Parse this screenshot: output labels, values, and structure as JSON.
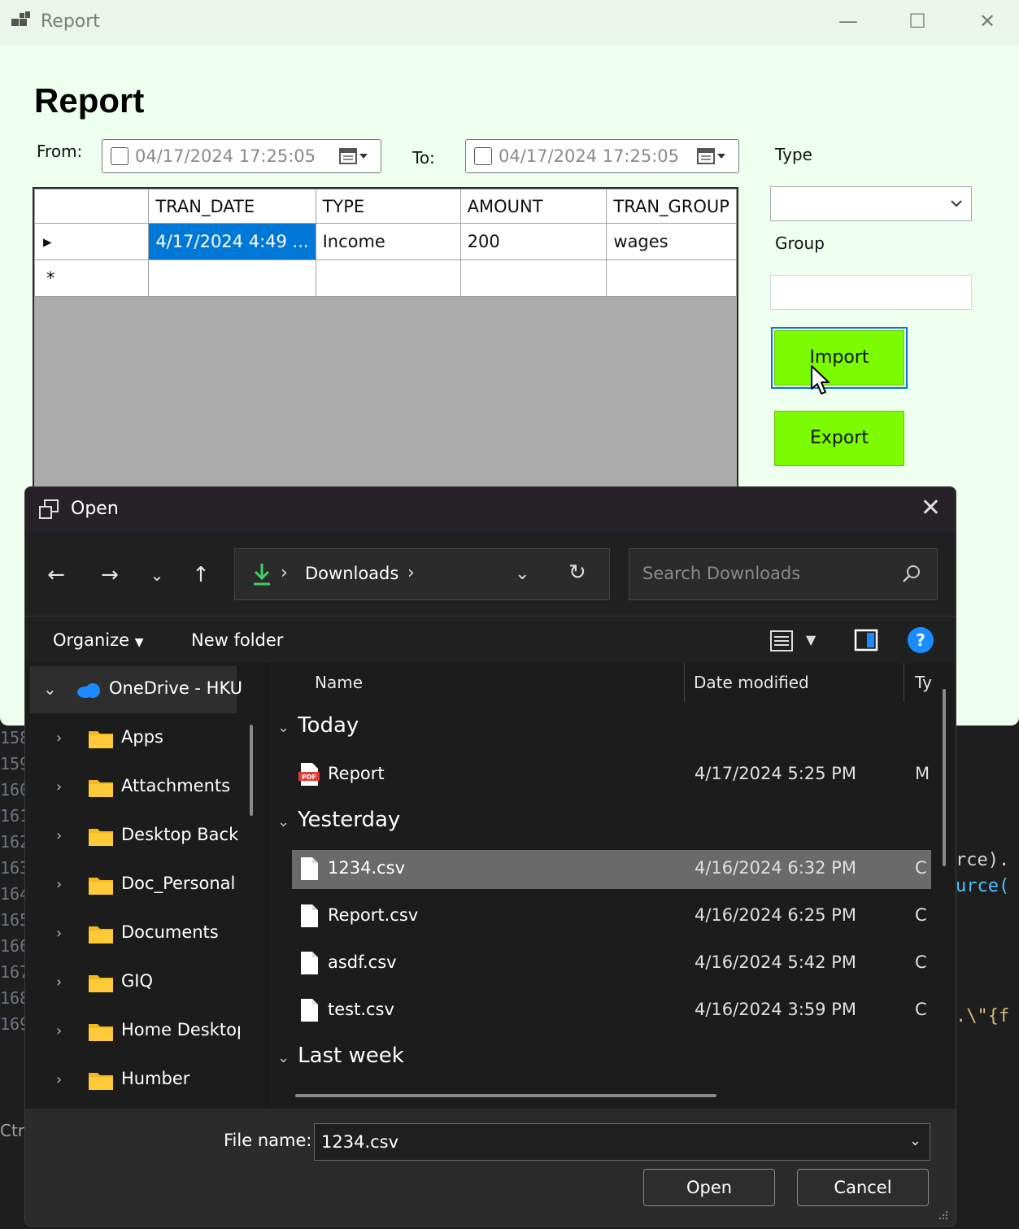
{
  "background": {
    "line_numbers": [
      "158",
      "159",
      "160",
      "161",
      "162",
      "163",
      "164",
      "165",
      "166",
      "167",
      "168",
      "169"
    ],
    "code": [
      "rce).",
      "urce(",
      ".\\\"{f"
    ],
    "ctrl_text": "Ctrl-"
  },
  "report_window": {
    "title": "Report",
    "heading": "Report",
    "from_label": "From:",
    "from_value": "04/17/2024 17:25:05",
    "to_label": "To:",
    "to_value": "04/17/2024 17:25:05",
    "type_label": "Type",
    "type_value": "",
    "group_label": "Group",
    "group_value": "",
    "import_label": "Import",
    "export_label": "Export",
    "grid": {
      "columns": [
        "TRAN_DATE",
        "TYPE",
        "AMOUNT",
        "TRAN_GROUP"
      ],
      "rows": [
        {
          "indicator": "▸",
          "cells": [
            "4/17/2024 4:49 ...",
            "Income",
            "200",
            "wages"
          ]
        },
        {
          "indicator": "*",
          "cells": [
            "",
            "",
            "",
            ""
          ]
        }
      ]
    }
  },
  "open_dialog": {
    "title": "Open",
    "address": {
      "folder": "Downloads"
    },
    "search_placeholder": "Search Downloads",
    "toolbar": {
      "organize": "Organize",
      "new_folder": "New folder",
      "help": "?"
    },
    "nav_root": "OneDrive - HKU",
    "nav_items": [
      "Apps",
      "Attachments",
      "Desktop Back",
      "Doc_Personal",
      "Documents",
      "GIQ",
      "Home Desktop",
      "Humber"
    ],
    "columns": {
      "name": "Name",
      "date": "Date modified",
      "type": "Ty"
    },
    "groups": [
      {
        "label": "Today",
        "files": [
          {
            "name": "Report",
            "date": "4/17/2024 5:25 PM",
            "type": "M",
            "icon": "pdf-icon",
            "selected": false
          }
        ]
      },
      {
        "label": "Yesterday",
        "files": [
          {
            "name": "1234.csv",
            "date": "4/16/2024 6:32 PM",
            "type": "C",
            "icon": "file-icon",
            "selected": true
          },
          {
            "name": "Report.csv",
            "date": "4/16/2024 6:25 PM",
            "type": "C",
            "icon": "file-icon",
            "selected": false
          },
          {
            "name": "asdf.csv",
            "date": "4/16/2024 5:42 PM",
            "type": "C",
            "icon": "file-icon",
            "selected": false
          },
          {
            "name": "test.csv",
            "date": "4/16/2024 3:59 PM",
            "type": "C",
            "icon": "file-icon",
            "selected": false
          }
        ]
      },
      {
        "label": "Last week",
        "files": []
      }
    ],
    "file_name_label": "File name:",
    "file_name_value": "1234.csv",
    "open_button": "Open",
    "cancel_button": "Cancel"
  },
  "colors": {
    "accent_green": "#7cfc00",
    "selection_blue": "#0078d7",
    "window_bg": "#efffef",
    "dialog_bg": "#202020"
  }
}
